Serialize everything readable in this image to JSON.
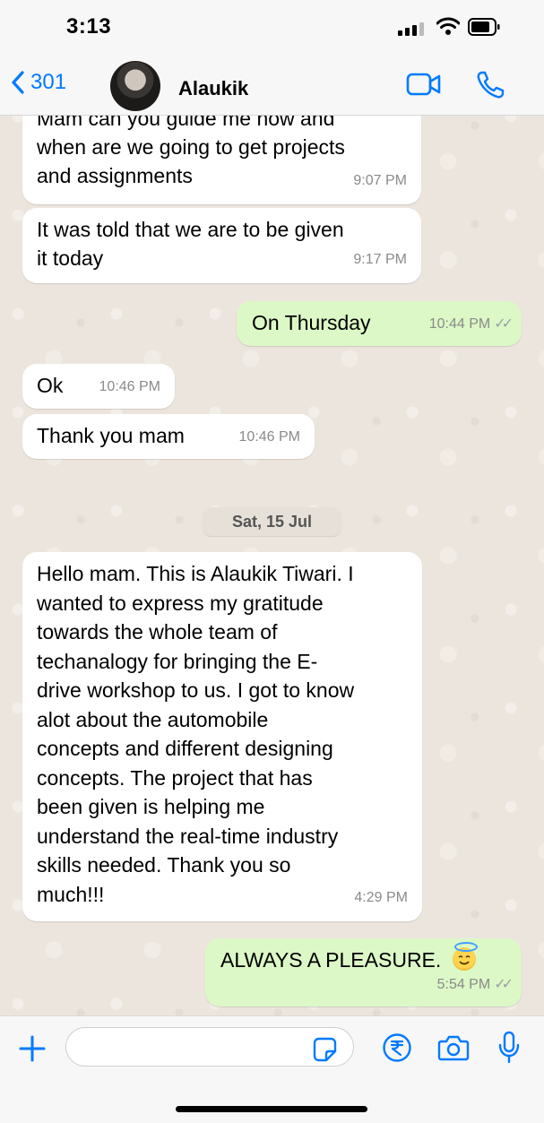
{
  "status_bar": {
    "time": "3:13",
    "signal_icon": "signal-bars-icon",
    "wifi_icon": "wifi-icon",
    "battery_icon": "battery-icon"
  },
  "header": {
    "back_count": "301",
    "contact_name": "Alaukik"
  },
  "messages": [
    {
      "direction": "in",
      "text": "Mam can you guide me now and\nwhen are we going to get projects\nand assignments",
      "time": "9:07 PM"
    },
    {
      "direction": "in",
      "text": "It was told that we are to be given\nit today",
      "time": "9:17 PM"
    },
    {
      "direction": "out",
      "text": "On Thursday",
      "time": "10:44 PM"
    },
    {
      "direction": "in",
      "text": "Ok",
      "time": "10:46 PM"
    },
    {
      "direction": "in",
      "text": "Thank you mam",
      "time": "10:46 PM"
    },
    {
      "direction": "in",
      "text": "Hello mam. This is Alaukik  Tiwari. I\nwanted to express my gratitude\ntowards the whole team of\ntechanalogy for bringing the E-\ndrive workshop to us. I got to know\nalot about the automobile\nconcepts and different designing\nconcepts. The project that has\nbeen given is helping me\nunderstand the real-time industry\nskills needed. Thank you so\nmuch!!!",
      "time": "4:29 PM"
    },
    {
      "direction": "out",
      "text": "ALWAYS A PLEASURE.",
      "emoji": "smiling-face-with-halo",
      "time": "5:54 PM"
    }
  ],
  "date_separator": "Sat, 15 Jul",
  "composer": {
    "placeholder": ""
  },
  "colors": {
    "accent": "#007aff",
    "outgoing_bubble": "#dcf8c6",
    "incoming_bubble": "#ffffff",
    "chat_background": "#ece5dd"
  }
}
